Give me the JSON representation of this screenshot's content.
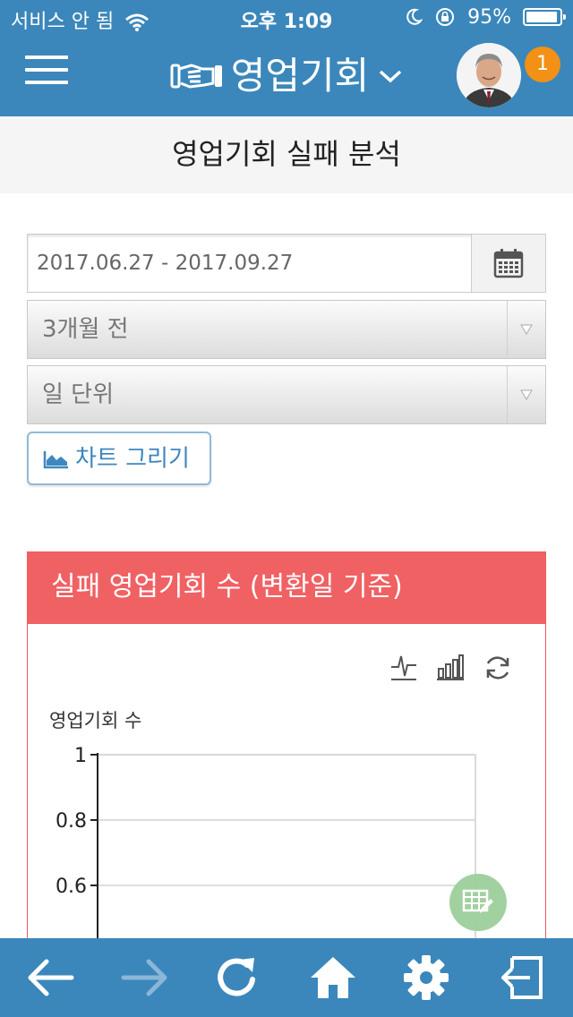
{
  "status_bar": {
    "carrier": "서비스 안 됨",
    "time": "오후 1:09",
    "battery": "95%",
    "battery_level": 0.95,
    "icons": [
      "wifi-icon",
      "moon-icon",
      "rotation-lock-icon",
      "battery-icon"
    ]
  },
  "header": {
    "title": "영업기회",
    "menu_icon": "hamburger-menu-icon",
    "title_icon": "handshake-icon",
    "dropdown_icon": "chevron-down-icon",
    "notification_count": "1",
    "colors": {
      "bar": "#3b87bb",
      "badge": "#f29115"
    }
  },
  "page": {
    "title": "영업기회 실패 분석"
  },
  "filters": {
    "date_range": "2017.06.27 - 2017.09.27",
    "calendar_icon": "calendar-icon",
    "period_select": "3개월 전",
    "unit_select": "일 단위",
    "draw_chart_button": "차트 그리기",
    "draw_chart_icon": "area-chart-icon"
  },
  "chart_panel": {
    "title": "실패 영업기회 수 (변환일 기준)",
    "header_color": "#f06164",
    "tools": [
      "line-chart-icon",
      "bar-chart-icon",
      "refresh-icon"
    ],
    "fab_icon": "table-edit-icon"
  },
  "chart_data": {
    "type": "line",
    "title": "",
    "ylabel": "영업기회 수",
    "xlabel": "",
    "ylim": [
      0,
      1
    ],
    "y_ticks_visible": [
      "1",
      "0.8",
      "0.6"
    ],
    "series": [],
    "grid": true
  },
  "bottom_toolbar": {
    "items": [
      "back-arrow-icon",
      "forward-arrow-icon",
      "reload-icon",
      "home-icon",
      "settings-gear-icon",
      "logout-icon"
    ]
  }
}
